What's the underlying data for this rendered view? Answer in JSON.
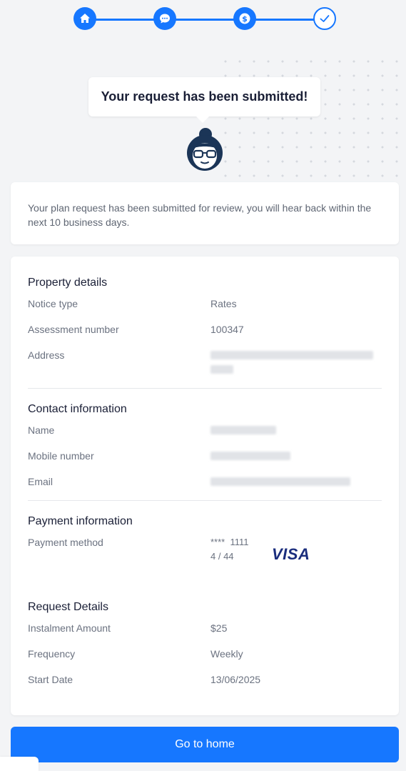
{
  "stepper": {
    "steps": [
      {
        "icon": "home-icon",
        "state": "complete"
      },
      {
        "icon": "chat-icon",
        "state": "complete"
      },
      {
        "icon": "dollar-icon",
        "state": "complete"
      },
      {
        "icon": "check-icon",
        "state": "current"
      }
    ],
    "accent": "#1677ff"
  },
  "bubble": {
    "text": "Your request has been submitted!"
  },
  "notice": {
    "text": "Your plan request has been submitted for review, you will hear back within the next 10 business days."
  },
  "property": {
    "title": "Property details",
    "notice_type_label": "Notice type",
    "notice_type_value": "Rates",
    "assessment_label": "Assessment number",
    "assessment_value": "100347",
    "address_label": "Address"
  },
  "contact": {
    "title": "Contact information",
    "name_label": "Name",
    "mobile_label": "Mobile number",
    "email_label": "Email"
  },
  "payment": {
    "title": "Payment information",
    "method_label": "Payment method",
    "card_number": "****  1111",
    "expiry": "4 / 44",
    "brand": "VISA"
  },
  "request": {
    "title": "Request Details",
    "amount_label": "Instalment Amount",
    "amount_value": "$25",
    "frequency_label": "Frequency",
    "frequency_value": "Weekly",
    "start_label": "Start Date",
    "start_value": "13/06/2025"
  },
  "home_button": {
    "label": "Go to home"
  }
}
